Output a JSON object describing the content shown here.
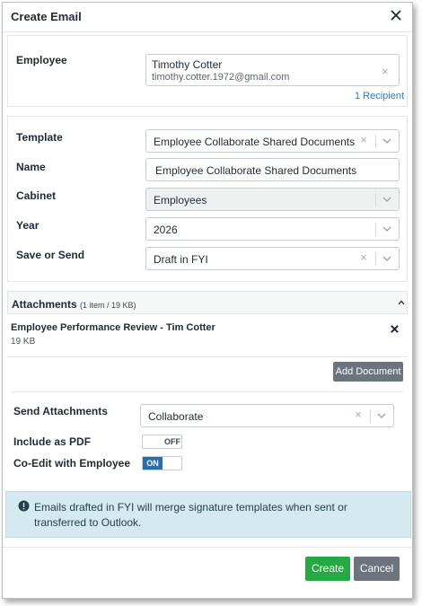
{
  "dialog": {
    "title": "Create Email"
  },
  "employee": {
    "label": "Employee",
    "name": "Timothy Cotter",
    "email": "timothy.cotter.1972@gmail.com",
    "recipients_link": "1 Recipient"
  },
  "form": {
    "template_label": "Template",
    "template_value": "Employee Collaborate Shared Documents",
    "name_label": "Name",
    "name_value": "Employee Collaborate Shared Documents",
    "cabinet_label": "Cabinet",
    "cabinet_value": "Employees",
    "year_label": "Year",
    "year_value": "2026",
    "save_label": "Save or Send",
    "save_value": "Draft in FYI"
  },
  "attachments": {
    "title": "Attachments",
    "count": "(1 item / 19 KB)",
    "items": [
      {
        "name": "Employee Performance Review - Tim Cotter",
        "size": "19 KB"
      }
    ],
    "add_button": "Add Document",
    "send_label": "Send Attachments",
    "send_value": "Collaborate",
    "pdf_label": "Include as PDF",
    "pdf_state": "OFF",
    "coedit_label": "Co-Edit with Employee",
    "coedit_state": "ON"
  },
  "info": {
    "message": "Emails drafted in FYI will merge signature templates when sent or transferred to Outlook."
  },
  "footer": {
    "create_label": "Create",
    "cancel_label": "Cancel"
  },
  "colors": {
    "primary_green": "#28a745",
    "cancel_grey": "#6c757d",
    "toggle_on": "#2b6fb3",
    "link_blue": "#2b7bc4",
    "info_bg": "#d3ebf0"
  }
}
